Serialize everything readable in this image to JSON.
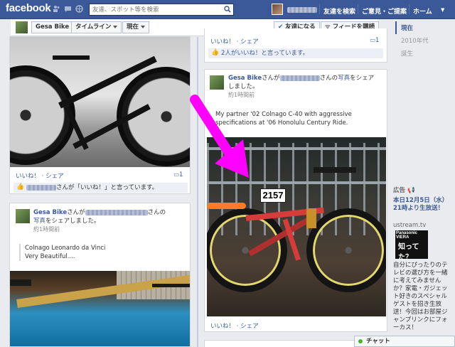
{
  "topbar": {
    "logo": "facebook",
    "search_placeholder": "友達、スポット等を検索",
    "nav": [
      "友達を検索",
      "ご意見・ご提案",
      "ホーム"
    ],
    "home_caret": "▼"
  },
  "timeline_bar": {
    "page_name": "Gesa Bike",
    "timeline_label": "タイムライン",
    "now_label": "現在",
    "friend_button": "友達になる",
    "subscribe_button": "フィードを購読"
  },
  "scrubber": [
    "現在",
    "2010年代",
    "誕生"
  ],
  "posts": {
    "left_top": {
      "actions": "いいね！ · シェア",
      "comment_count": "1",
      "like_text": "さんが「いいね！」と言っています。"
    },
    "left_bottom": {
      "author": "Gesa Bike",
      "text_a": "さんが",
      "text_b": "さんの",
      "text_c": "写真",
      "text_d": "をシェアしました。",
      "time": "約1時間前",
      "quote_line1": "Colnago Leonardo da Vinci",
      "quote_line2": "Very Beautiful...."
    },
    "right_top": {
      "actions": "いいね！ · シェア",
      "comment_count": "1",
      "like_text": "2人がいいね！と言っています。"
    },
    "right_main": {
      "author": "Gesa Bike",
      "text_a": "さんが",
      "text_b": "さんの",
      "text_c": "写真",
      "text_d": "をシェア",
      "text_e": "しました。",
      "time": "約1時間前",
      "caption_line1": "My partner '02 Colnago C-40 with aggressive",
      "caption_line2": "specifications at '06 Honolulu Century Ride.",
      "plate_number": "2157",
      "actions": "いいね！ · シェア"
    }
  },
  "ad": {
    "header": "広告",
    "title": "本日12月5日（水）21時より生放送！",
    "url": "ustream.tv",
    "img_brand": "Panasonic VIERA",
    "img_text": "知ってた？",
    "body": "自分にぴったりのテレビの選び方を一緒に考えてみませんか？家電・ガジェット好きのスペシャルゲストを招き生放送！今回はお部屋ジャンプリンクにフォーカス！"
  },
  "chat": {
    "label": "チャット"
  },
  "colors": {
    "brand": "#3b5998",
    "arrow": "#ff00ff"
  }
}
